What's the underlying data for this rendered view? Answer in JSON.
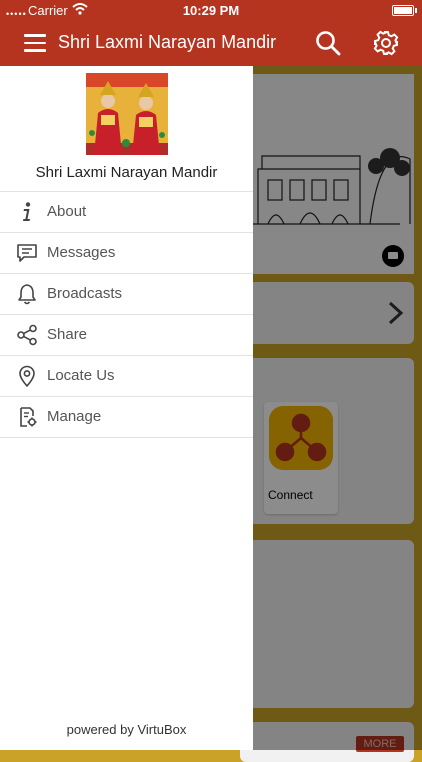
{
  "status_bar": {
    "carrier": "Carrier",
    "time": "10:29 PM"
  },
  "nav": {
    "title": "Shri Laxmi Narayan Mandir"
  },
  "drawer": {
    "temple_name": "Shri Laxmi Narayan Mandir",
    "items": [
      {
        "label": "About",
        "icon": "info-icon"
      },
      {
        "label": "Messages",
        "icon": "message-icon"
      },
      {
        "label": "Broadcasts",
        "icon": "bell-icon"
      },
      {
        "label": "Share",
        "icon": "share-icon"
      },
      {
        "label": "Locate Us",
        "icon": "location-pin-icon"
      },
      {
        "label": "Manage",
        "icon": "manage-icon"
      }
    ],
    "footer": "powered by VirtuBox"
  },
  "background": {
    "connect_label": "Connect",
    "more_label": "MORE"
  },
  "colors": {
    "brand": "#b5341f",
    "accent": "#c9a227"
  }
}
